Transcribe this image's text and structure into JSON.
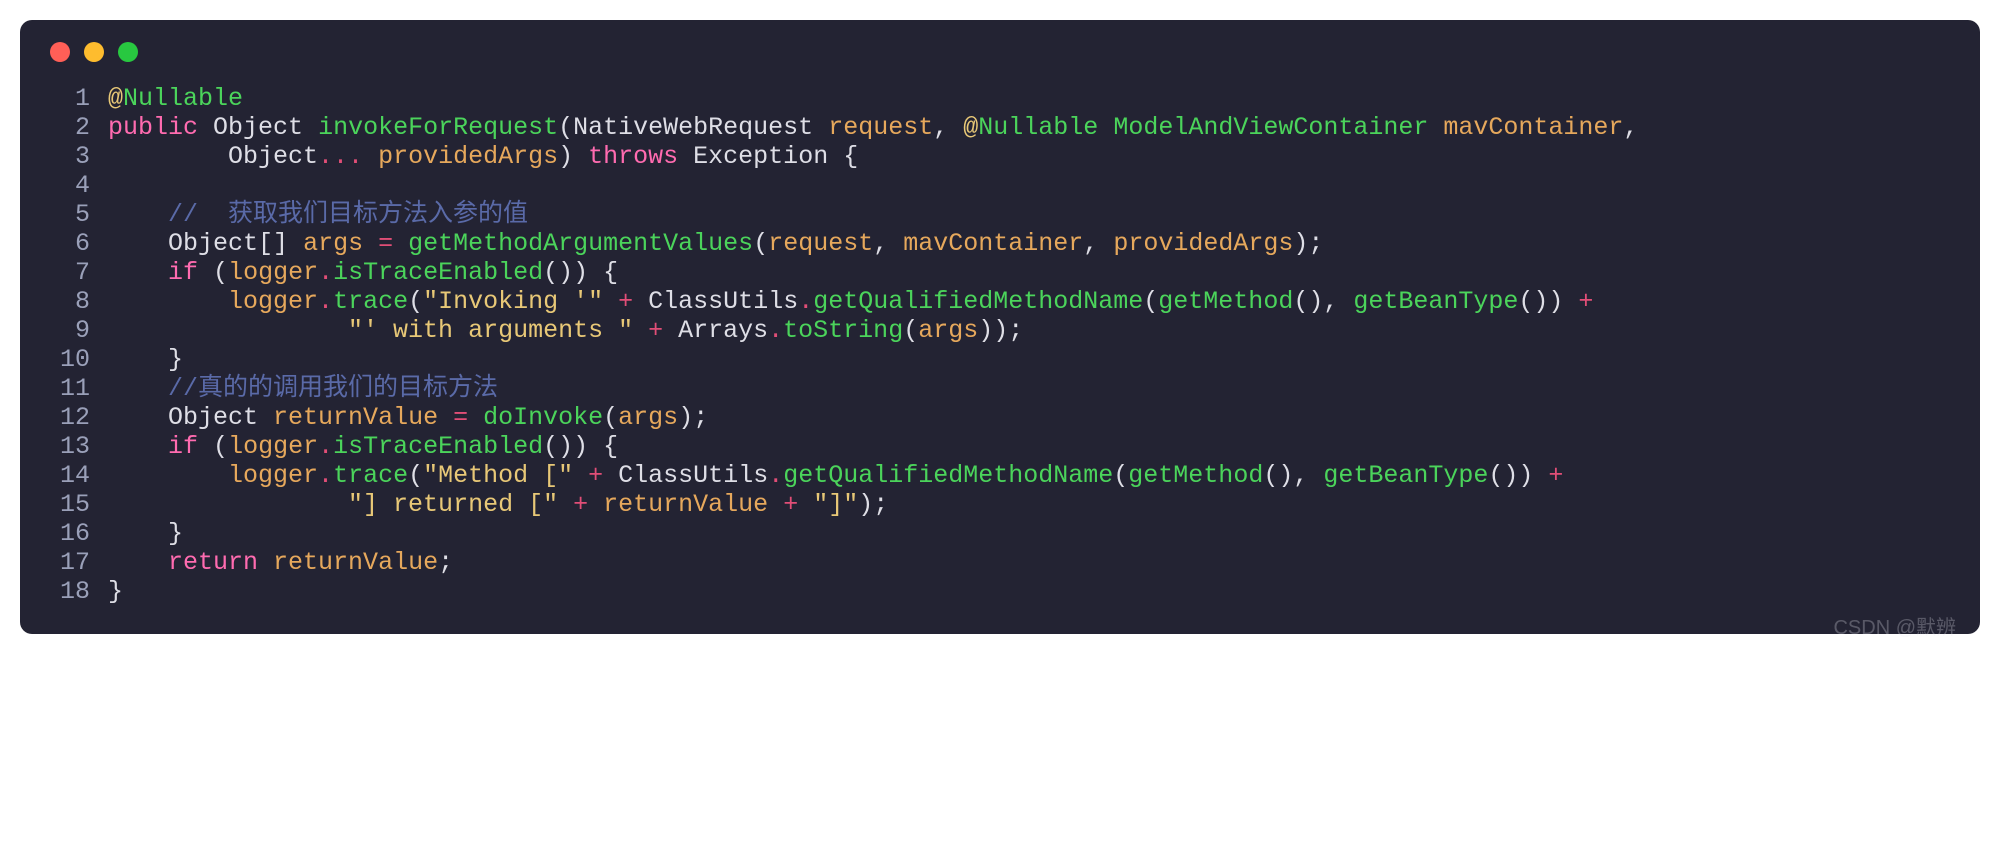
{
  "traffic": {
    "red": "#ff5f57",
    "yellow": "#febc2e",
    "green": "#28c840"
  },
  "watermark": "CSDN @默辨",
  "lines": [
    {
      "n": 1,
      "tokens": [
        {
          "c": "ann-at",
          "t": "@"
        },
        {
          "c": "ann-name",
          "t": "Nullable"
        }
      ]
    },
    {
      "n": 2,
      "tokens": [
        {
          "c": "kw",
          "t": "public"
        },
        {
          "c": "var",
          "t": " "
        },
        {
          "c": "type",
          "t": "Object"
        },
        {
          "c": "var",
          "t": " "
        },
        {
          "c": "method",
          "t": "invokeForRequest"
        },
        {
          "c": "punct",
          "t": "("
        },
        {
          "c": "type",
          "t": "NativeWebRequest"
        },
        {
          "c": "var",
          "t": " "
        },
        {
          "c": "param",
          "t": "request"
        },
        {
          "c": "punct",
          "t": ","
        },
        {
          "c": "var",
          "t": " "
        },
        {
          "c": "ann-at",
          "t": "@"
        },
        {
          "c": "ann-name",
          "t": "Nullable"
        },
        {
          "c": "var",
          "t": " "
        },
        {
          "c": "method",
          "t": "ModelAndViewContainer"
        },
        {
          "c": "var",
          "t": " "
        },
        {
          "c": "param",
          "t": "mavContainer"
        },
        {
          "c": "punct",
          "t": ","
        }
      ]
    },
    {
      "n": 3,
      "tokens": [
        {
          "c": "var",
          "t": "        "
        },
        {
          "c": "type",
          "t": "Object"
        },
        {
          "c": "op",
          "t": "..."
        },
        {
          "c": "var",
          "t": " "
        },
        {
          "c": "param",
          "t": "providedArgs"
        },
        {
          "c": "punct",
          "t": ")"
        },
        {
          "c": "var",
          "t": " "
        },
        {
          "c": "kw",
          "t": "throws"
        },
        {
          "c": "var",
          "t": " "
        },
        {
          "c": "type",
          "t": "Exception"
        },
        {
          "c": "var",
          "t": " "
        },
        {
          "c": "punct",
          "t": "{"
        }
      ]
    },
    {
      "n": 4,
      "tokens": [
        {
          "c": "var",
          "t": ""
        }
      ]
    },
    {
      "n": 5,
      "tokens": [
        {
          "c": "var",
          "t": "    "
        },
        {
          "c": "comment",
          "t": "//  获取我们目标方法入参的值"
        }
      ]
    },
    {
      "n": 6,
      "tokens": [
        {
          "c": "var",
          "t": "    "
        },
        {
          "c": "type",
          "t": "Object"
        },
        {
          "c": "punct",
          "t": "[]"
        },
        {
          "c": "var",
          "t": " "
        },
        {
          "c": "param",
          "t": "args"
        },
        {
          "c": "var",
          "t": " "
        },
        {
          "c": "op",
          "t": "="
        },
        {
          "c": "var",
          "t": " "
        },
        {
          "c": "method",
          "t": "getMethodArgumentValues"
        },
        {
          "c": "punct",
          "t": "("
        },
        {
          "c": "param",
          "t": "request"
        },
        {
          "c": "punct",
          "t": ","
        },
        {
          "c": "var",
          "t": " "
        },
        {
          "c": "param",
          "t": "mavContainer"
        },
        {
          "c": "punct",
          "t": ","
        },
        {
          "c": "var",
          "t": " "
        },
        {
          "c": "param",
          "t": "providedArgs"
        },
        {
          "c": "punct",
          "t": ");"
        }
      ]
    },
    {
      "n": 7,
      "tokens": [
        {
          "c": "var",
          "t": "    "
        },
        {
          "c": "kw",
          "t": "if"
        },
        {
          "c": "var",
          "t": " "
        },
        {
          "c": "punct",
          "t": "("
        },
        {
          "c": "param",
          "t": "logger"
        },
        {
          "c": "op",
          "t": "."
        },
        {
          "c": "method",
          "t": "isTraceEnabled"
        },
        {
          "c": "punct",
          "t": "())"
        },
        {
          "c": "var",
          "t": " "
        },
        {
          "c": "punct",
          "t": "{"
        }
      ]
    },
    {
      "n": 8,
      "tokens": [
        {
          "c": "var",
          "t": "        "
        },
        {
          "c": "param",
          "t": "logger"
        },
        {
          "c": "op",
          "t": "."
        },
        {
          "c": "method",
          "t": "trace"
        },
        {
          "c": "punct",
          "t": "("
        },
        {
          "c": "str",
          "t": "\"Invoking '\""
        },
        {
          "c": "var",
          "t": " "
        },
        {
          "c": "op",
          "t": "+"
        },
        {
          "c": "var",
          "t": " "
        },
        {
          "c": "type",
          "t": "ClassUtils"
        },
        {
          "c": "op",
          "t": "."
        },
        {
          "c": "method",
          "t": "getQualifiedMethodName"
        },
        {
          "c": "punct",
          "t": "("
        },
        {
          "c": "method",
          "t": "getMethod"
        },
        {
          "c": "punct",
          "t": "(),"
        },
        {
          "c": "var",
          "t": " "
        },
        {
          "c": "method",
          "t": "getBeanType"
        },
        {
          "c": "punct",
          "t": "())"
        },
        {
          "c": "var",
          "t": " "
        },
        {
          "c": "op",
          "t": "+"
        }
      ]
    },
    {
      "n": 9,
      "tokens": [
        {
          "c": "var",
          "t": "                "
        },
        {
          "c": "str",
          "t": "\"' with arguments \""
        },
        {
          "c": "var",
          "t": " "
        },
        {
          "c": "op",
          "t": "+"
        },
        {
          "c": "var",
          "t": " "
        },
        {
          "c": "type",
          "t": "Arrays"
        },
        {
          "c": "op",
          "t": "."
        },
        {
          "c": "method",
          "t": "toString"
        },
        {
          "c": "punct",
          "t": "("
        },
        {
          "c": "param",
          "t": "args"
        },
        {
          "c": "punct",
          "t": "));"
        }
      ]
    },
    {
      "n": 10,
      "tokens": [
        {
          "c": "var",
          "t": "    "
        },
        {
          "c": "punct",
          "t": "}"
        }
      ]
    },
    {
      "n": 11,
      "tokens": [
        {
          "c": "var",
          "t": "    "
        },
        {
          "c": "comment",
          "t": "//真的的调用我们的目标方法"
        }
      ]
    },
    {
      "n": 12,
      "tokens": [
        {
          "c": "var",
          "t": "    "
        },
        {
          "c": "type",
          "t": "Object"
        },
        {
          "c": "var",
          "t": " "
        },
        {
          "c": "param",
          "t": "returnValue"
        },
        {
          "c": "var",
          "t": " "
        },
        {
          "c": "op",
          "t": "="
        },
        {
          "c": "var",
          "t": " "
        },
        {
          "c": "method",
          "t": "doInvoke"
        },
        {
          "c": "punct",
          "t": "("
        },
        {
          "c": "param",
          "t": "args"
        },
        {
          "c": "punct",
          "t": ");"
        }
      ]
    },
    {
      "n": 13,
      "tokens": [
        {
          "c": "var",
          "t": "    "
        },
        {
          "c": "kw",
          "t": "if"
        },
        {
          "c": "var",
          "t": " "
        },
        {
          "c": "punct",
          "t": "("
        },
        {
          "c": "param",
          "t": "logger"
        },
        {
          "c": "op",
          "t": "."
        },
        {
          "c": "method",
          "t": "isTraceEnabled"
        },
        {
          "c": "punct",
          "t": "())"
        },
        {
          "c": "var",
          "t": " "
        },
        {
          "c": "punct",
          "t": "{"
        }
      ]
    },
    {
      "n": 14,
      "tokens": [
        {
          "c": "var",
          "t": "        "
        },
        {
          "c": "param",
          "t": "logger"
        },
        {
          "c": "op",
          "t": "."
        },
        {
          "c": "method",
          "t": "trace"
        },
        {
          "c": "punct",
          "t": "("
        },
        {
          "c": "str",
          "t": "\"Method [\""
        },
        {
          "c": "var",
          "t": " "
        },
        {
          "c": "op",
          "t": "+"
        },
        {
          "c": "var",
          "t": " "
        },
        {
          "c": "type",
          "t": "ClassUtils"
        },
        {
          "c": "op",
          "t": "."
        },
        {
          "c": "method",
          "t": "getQualifiedMethodName"
        },
        {
          "c": "punct",
          "t": "("
        },
        {
          "c": "method",
          "t": "getMethod"
        },
        {
          "c": "punct",
          "t": "(),"
        },
        {
          "c": "var",
          "t": " "
        },
        {
          "c": "method",
          "t": "getBeanType"
        },
        {
          "c": "punct",
          "t": "())"
        },
        {
          "c": "var",
          "t": " "
        },
        {
          "c": "op",
          "t": "+"
        }
      ]
    },
    {
      "n": 15,
      "tokens": [
        {
          "c": "var",
          "t": "                "
        },
        {
          "c": "str",
          "t": "\"] returned [\""
        },
        {
          "c": "var",
          "t": " "
        },
        {
          "c": "op",
          "t": "+"
        },
        {
          "c": "var",
          "t": " "
        },
        {
          "c": "param",
          "t": "returnValue"
        },
        {
          "c": "var",
          "t": " "
        },
        {
          "c": "op",
          "t": "+"
        },
        {
          "c": "var",
          "t": " "
        },
        {
          "c": "str",
          "t": "\"]\""
        },
        {
          "c": "punct",
          "t": ");"
        }
      ]
    },
    {
      "n": 16,
      "tokens": [
        {
          "c": "var",
          "t": "    "
        },
        {
          "c": "punct",
          "t": "}"
        }
      ]
    },
    {
      "n": 17,
      "tokens": [
        {
          "c": "var",
          "t": "    "
        },
        {
          "c": "kw",
          "t": "return"
        },
        {
          "c": "var",
          "t": " "
        },
        {
          "c": "param",
          "t": "returnValue"
        },
        {
          "c": "punct",
          "t": ";"
        }
      ]
    },
    {
      "n": 18,
      "tokens": [
        {
          "c": "punct",
          "t": "}"
        }
      ]
    }
  ]
}
